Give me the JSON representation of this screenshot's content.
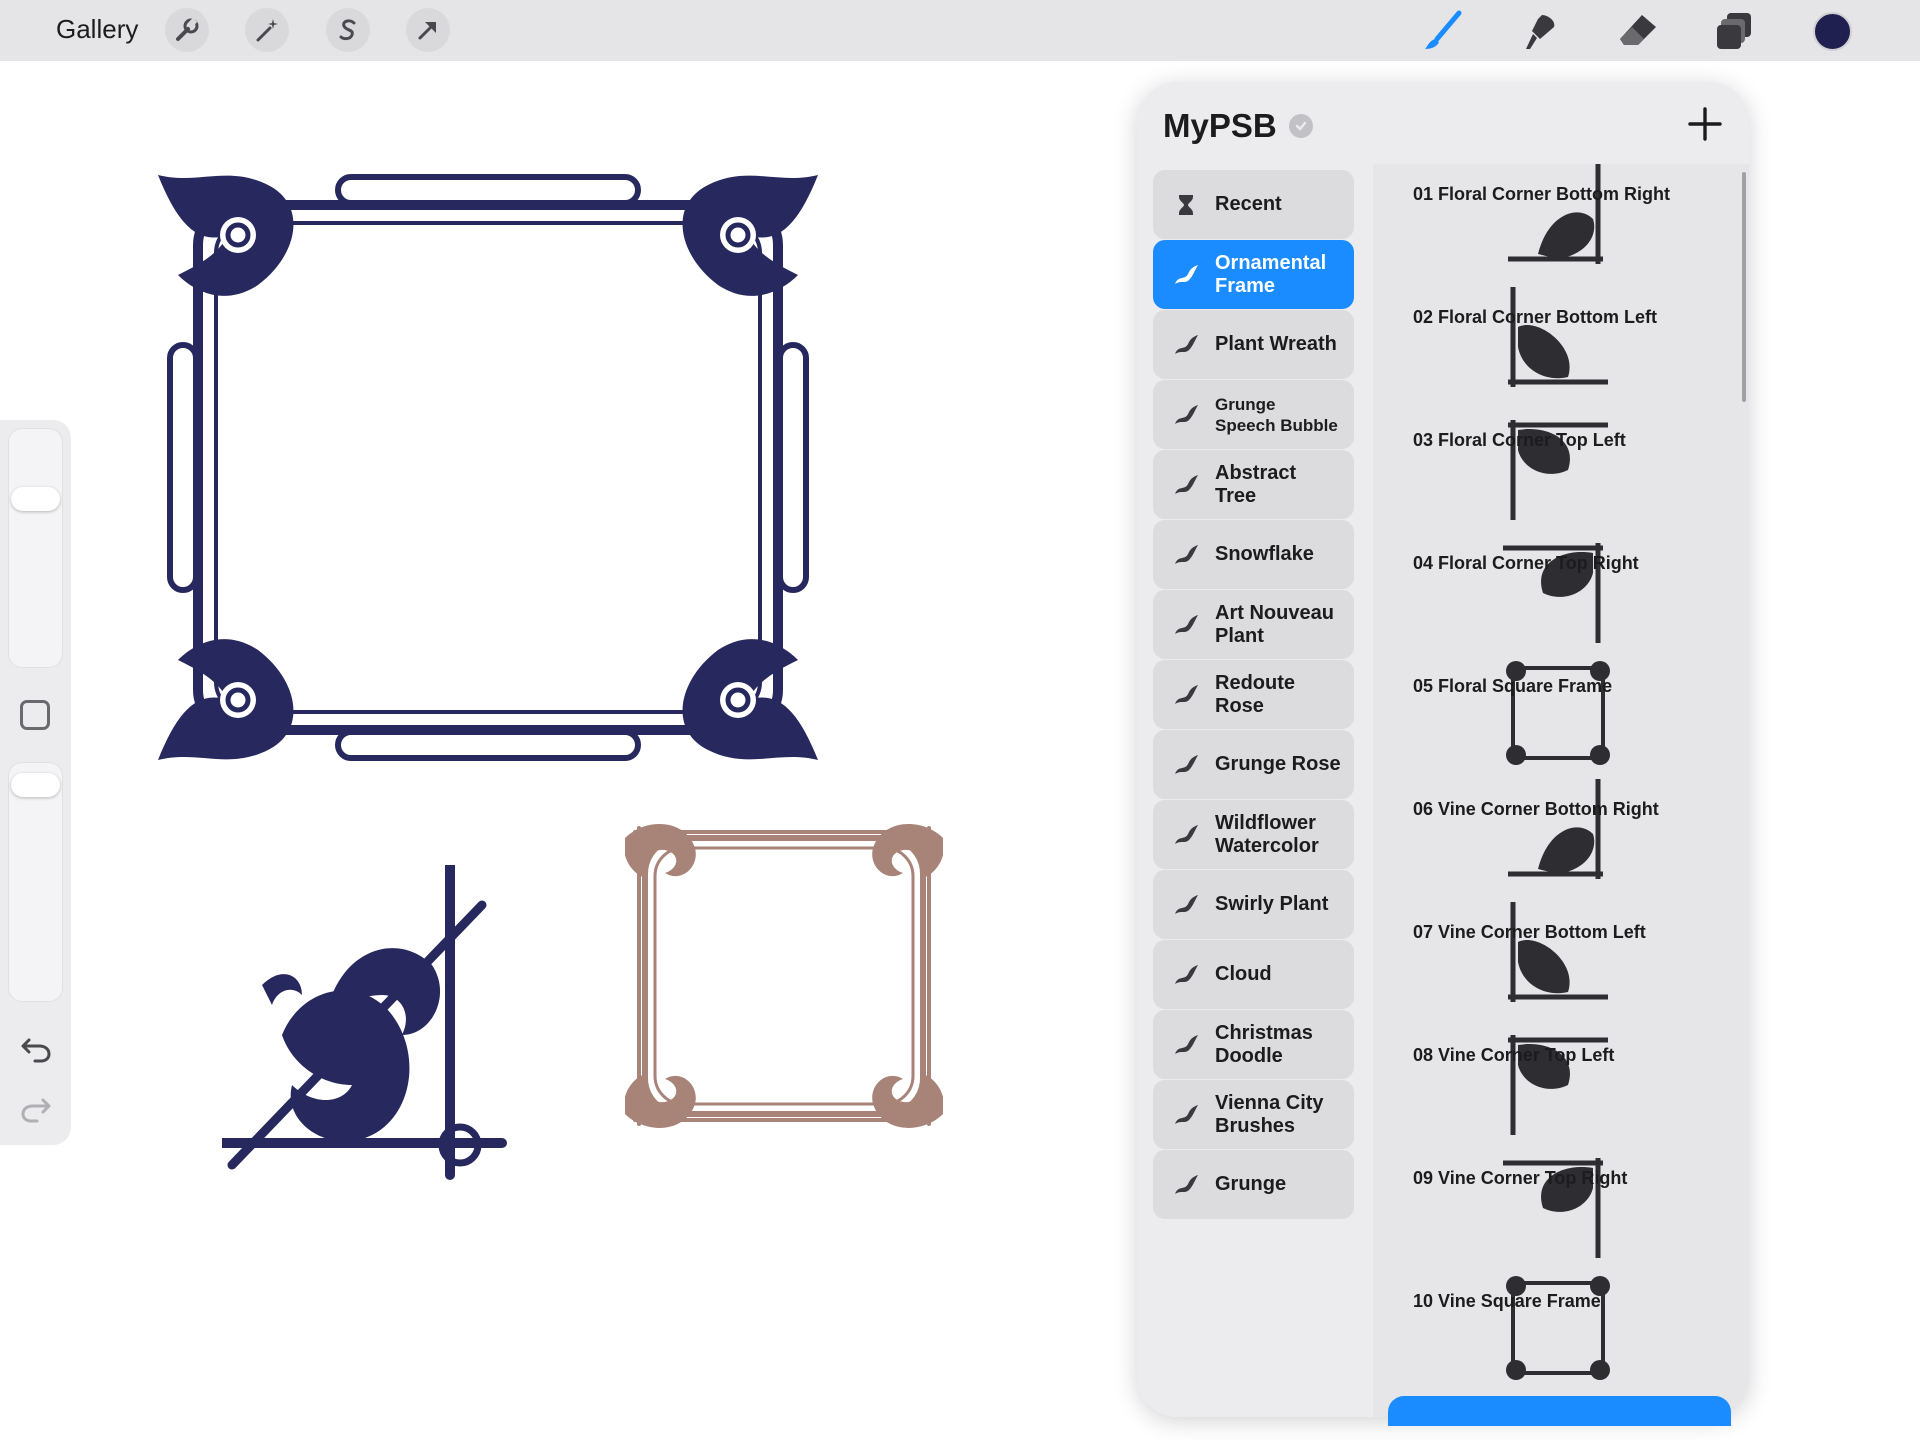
{
  "toolbar": {
    "gallery_label": "Gallery",
    "left_tools": [
      "wrench-icon",
      "magic-wand-icon",
      "selection-s-icon",
      "transform-arrow-icon"
    ],
    "right_tools": [
      "brush-icon",
      "smudge-icon",
      "eraser-icon",
      "layers-icon"
    ],
    "current_color": "#1f2050"
  },
  "sidebar": {
    "size_level": 0.28,
    "opacity_level": 0.95
  },
  "panel": {
    "title": "MyPSB",
    "accent": "#1a8cff",
    "brush_sets": [
      {
        "label": "Recent",
        "icon": "hourglass-icon",
        "active": false
      },
      {
        "label": "Ornamental\nFrame",
        "icon": "brush-stroke-icon",
        "active": true
      },
      {
        "label": "Plant Wreath",
        "icon": "brush-stroke-icon",
        "active": false
      },
      {
        "label": "Grunge\nSpeech Bubble",
        "icon": "brush-stroke-icon",
        "active": false
      },
      {
        "label": "Abstract\nTree",
        "icon": "brush-stroke-icon",
        "active": false
      },
      {
        "label": "Snowflake",
        "icon": "brush-stroke-icon",
        "active": false
      },
      {
        "label": "Art Nouveau\nPlant",
        "icon": "brush-stroke-icon",
        "active": false
      },
      {
        "label": "Redoute\nRose",
        "icon": "brush-stroke-icon",
        "active": false
      },
      {
        "label": "Grunge Rose",
        "icon": "brush-stroke-icon",
        "active": false
      },
      {
        "label": "Wildflower\nWatercolor",
        "icon": "brush-stroke-icon",
        "active": false
      },
      {
        "label": "Swirly Plant",
        "icon": "brush-stroke-icon",
        "active": false
      },
      {
        "label": "Cloud",
        "icon": "brush-stroke-icon",
        "active": false
      },
      {
        "label": "Christmas\nDoodle",
        "icon": "brush-stroke-icon",
        "active": false
      },
      {
        "label": "Vienna City\nBrushes",
        "icon": "brush-stroke-icon",
        "active": false
      },
      {
        "label": "Grunge",
        "icon": "brush-stroke-icon",
        "active": false
      }
    ],
    "brushes": [
      {
        "name": "01 Floral Corner Bottom Right",
        "preview": "corner-br"
      },
      {
        "name": "02 Floral Corner Bottom Left",
        "preview": "corner-bl"
      },
      {
        "name": "03 Floral Corner Top Left",
        "preview": "corner-tl"
      },
      {
        "name": "04 Floral Corner Top Right",
        "preview": "corner-tr"
      },
      {
        "name": "05 Floral Square Frame",
        "preview": "frame"
      },
      {
        "name": "06 Vine Corner Bottom Right",
        "preview": "corner-br"
      },
      {
        "name": "07 Vine Corner Bottom Left",
        "preview": "corner-bl"
      },
      {
        "name": "08 Vine Corner Top Left",
        "preview": "corner-tl"
      },
      {
        "name": "09 Vine Corner Top Right",
        "preview": "corner-tr"
      },
      {
        "name": "10 Vine Square Frame",
        "preview": "frame"
      }
    ]
  }
}
